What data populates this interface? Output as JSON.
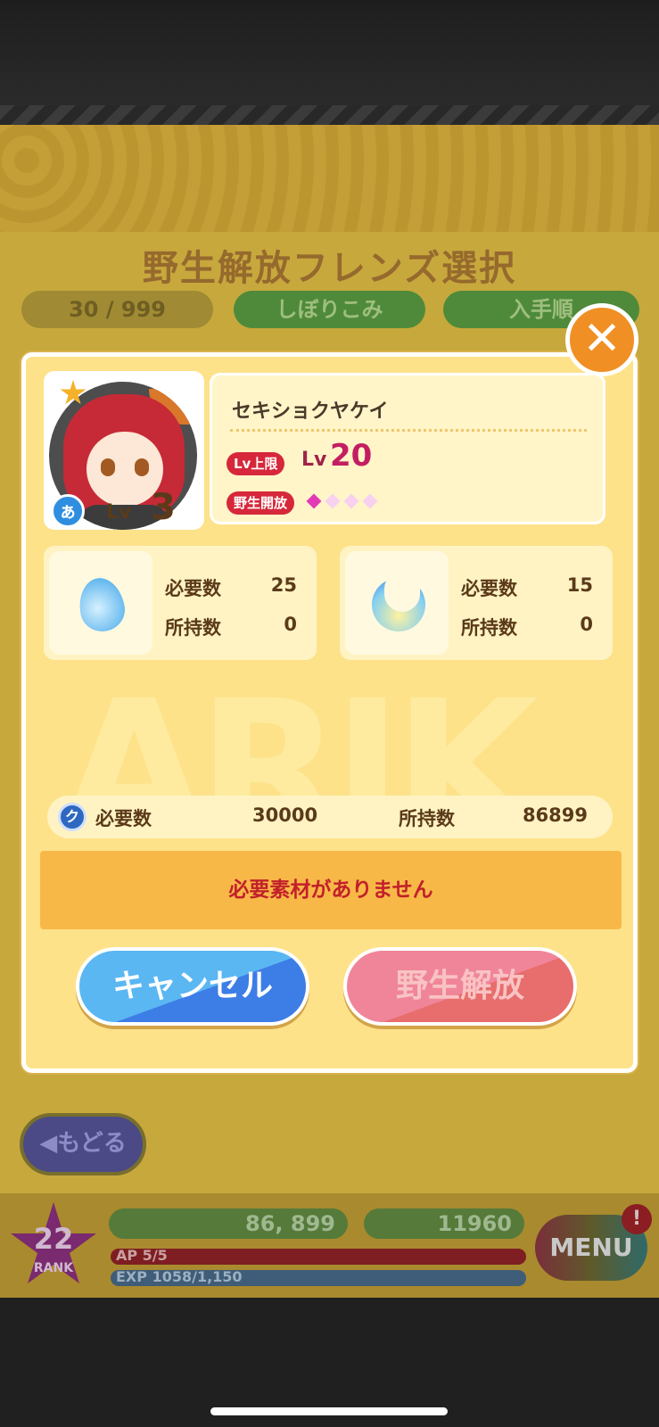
{
  "background_screen": {
    "title": "野生解放フレンズ選択",
    "count": "30 / 999",
    "filter_label": "しぼりこみ",
    "sort_label": "入手順",
    "back_label": "◀もどる"
  },
  "hud": {
    "rank_number": "22",
    "rank_label": "RANK",
    "coins": "86, 899",
    "tickets": "11960",
    "ap_text": "AP 5/5",
    "exp_text": "EXP 1058/1,150",
    "menu_label": "MENU",
    "alert": "!"
  },
  "dialog": {
    "close_icon": "✕",
    "friend": {
      "name": "セキショクヤケイ",
      "level_label": "Lv",
      "level": "3",
      "attribute_icon": "ぁ",
      "lv_limit_tag": "Lv上限",
      "lv_limit_prefix": "Lv",
      "lv_limit_value": "20",
      "wild_release_tag": "野生開放",
      "wild_release_stage": 1,
      "wild_release_max": 4
    },
    "materials": [
      {
        "icon": "blue-drop-icon",
        "required_label": "必要数",
        "required": "25",
        "owned_label": "所持数",
        "owned": "0"
      },
      {
        "icon": "crescent-moon-icon",
        "required_label": "必要数",
        "required": "15",
        "owned_label": "所持数",
        "owned": "0"
      }
    ],
    "coins": {
      "icon": "ク",
      "required_label": "必要数",
      "required": "30000",
      "owned_label": "所持数",
      "owned": "86899"
    },
    "warning": "必要素材がありません",
    "cancel_label": "キャンセル",
    "release_label": "野生解放"
  },
  "colors": {
    "dialog_bg": "#fde28a",
    "close": "#f08f24",
    "cancel": "#4a9cec",
    "release_disabled": "#ee7d88",
    "warning_text": "#c2202a"
  }
}
